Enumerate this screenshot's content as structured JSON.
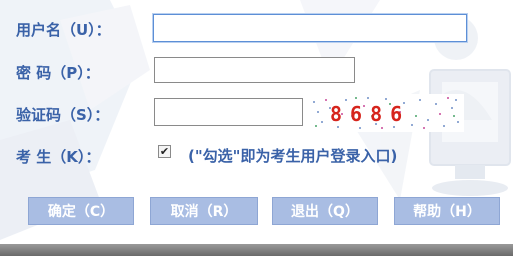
{
  "form": {
    "username_label": "用户名（U）：",
    "password_label": "密  码（P）：",
    "captcha_label": "验证码（S）：",
    "examinee_label": "考  生（K）：",
    "username_value": "",
    "password_value": "",
    "captcha_value": "",
    "captcha_code": "8686",
    "examinee_checked": true,
    "checkmark": "✔",
    "examinee_hint": "(\"勾选\"即为考生用户登录入口)"
  },
  "buttons": {
    "confirm": "确定（C）",
    "cancel": "取消（R）",
    "exit": "退出（Q）",
    "help": "帮助（H）"
  },
  "colors": {
    "label": "#3a62a8",
    "button_bg": "#a9bde3",
    "captcha_text": "#d6241c",
    "input_focus": "#5d8fd6"
  }
}
